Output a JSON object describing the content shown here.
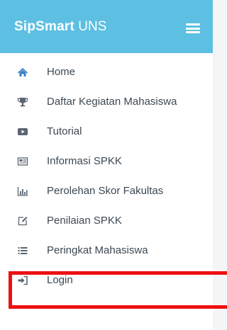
{
  "brand": {
    "bold": "SipSmart",
    "light": " UNS"
  },
  "menu_icon": "hamburger-icon",
  "nav": {
    "items": [
      {
        "label": "Home",
        "icon": "home-icon"
      },
      {
        "label": "Daftar Kegiatan Mahasiswa",
        "icon": "trophy-icon"
      },
      {
        "label": "Tutorial",
        "icon": "youtube-play-icon"
      },
      {
        "label": "Informasi SPKK",
        "icon": "newspaper-icon"
      },
      {
        "label": "Perolehan Skor Fakultas",
        "icon": "bar-chart-icon"
      },
      {
        "label": "Penilaian SPKK",
        "icon": "edit-icon"
      },
      {
        "label": "Peringkat Mahasiswa",
        "icon": "list-icon"
      },
      {
        "label": "Login",
        "icon": "sign-in-icon"
      }
    ]
  },
  "colors": {
    "header": "#5dbfe2",
    "icon": "#5a6570",
    "home_icon": "#3b7fc4",
    "highlight": "#ee1111"
  }
}
